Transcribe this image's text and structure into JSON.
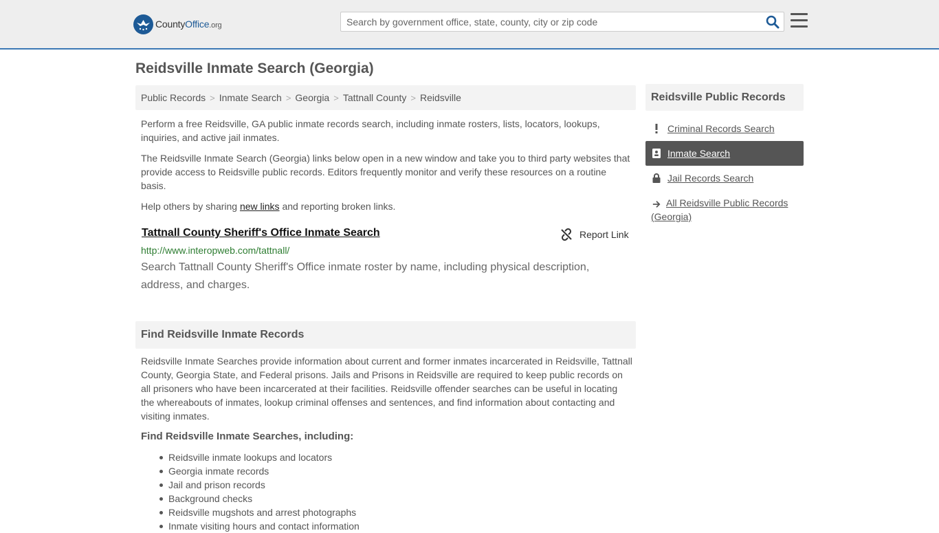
{
  "header": {
    "logo_name": "County",
    "logo_office": "Office",
    "logo_tld": ".org",
    "search_placeholder": "Search by government office, state, county, city or zip code",
    "brand_color": "#1d5a96",
    "accent_border": "#3c78b4"
  },
  "page": {
    "title": "Reidsville Inmate Search (Georgia)"
  },
  "breadcrumb": [
    "Public Records",
    "Inmate Search",
    "Georgia",
    "Tattnall County",
    "Reidsville"
  ],
  "intro": {
    "p1": "Perform a free Reidsville, GA public inmate records search, including inmate rosters, lists, locators, lookups, inquiries, and active jail inmates.",
    "p2": "The Reidsville Inmate Search (Georgia) links below open in a new window and take you to third party websites that provide access to Reidsville public records. Editors frequently monitor and verify these resources on a routine basis.",
    "p3_before": "Help others by sharing ",
    "p3_link": "new links",
    "p3_after": " and reporting broken links."
  },
  "result": {
    "title": "Tattnall County Sheriff's Office Inmate Search",
    "report_label": "Report Link",
    "url": "http://www.interopweb.com/tattnall/",
    "description": "Search Tattnall County Sheriff's Office inmate roster by name, including physical description, address, and charges."
  },
  "section": {
    "heading": "Find Reidsville Inmate Records",
    "text": "Reidsville Inmate Searches provide information about current and former inmates incarcerated in Reidsville, Tattnall County, Georgia State, and Federal prisons. Jails and Prisons in Reidsville are required to keep public records on all prisoners who have been incarcerated at their facilities. Reidsville offender searches can be useful in locating the whereabouts of inmates, lookup criminal offenses and sentences, and find information about contacting and visiting inmates.",
    "sub_heading": "Find Reidsville Inmate Searches, including:",
    "list": [
      "Reidsville inmate lookups and locators",
      "Georgia inmate records",
      "Jail and prison records",
      "Background checks",
      "Reidsville mugshots and arrest photographs",
      "Inmate visiting hours and contact information"
    ]
  },
  "sidebar": {
    "heading": "Reidsville Public Records",
    "items": [
      {
        "label": "Criminal Records Search",
        "icon": "exclamation-icon"
      },
      {
        "label": "Inmate Search",
        "icon": "id-badge-icon",
        "active": true
      },
      {
        "label": "Jail Records Search",
        "icon": "lock-icon"
      },
      {
        "label": "All Reidsville Public Records (Georgia)",
        "icon": "arrow-right-icon"
      }
    ]
  }
}
